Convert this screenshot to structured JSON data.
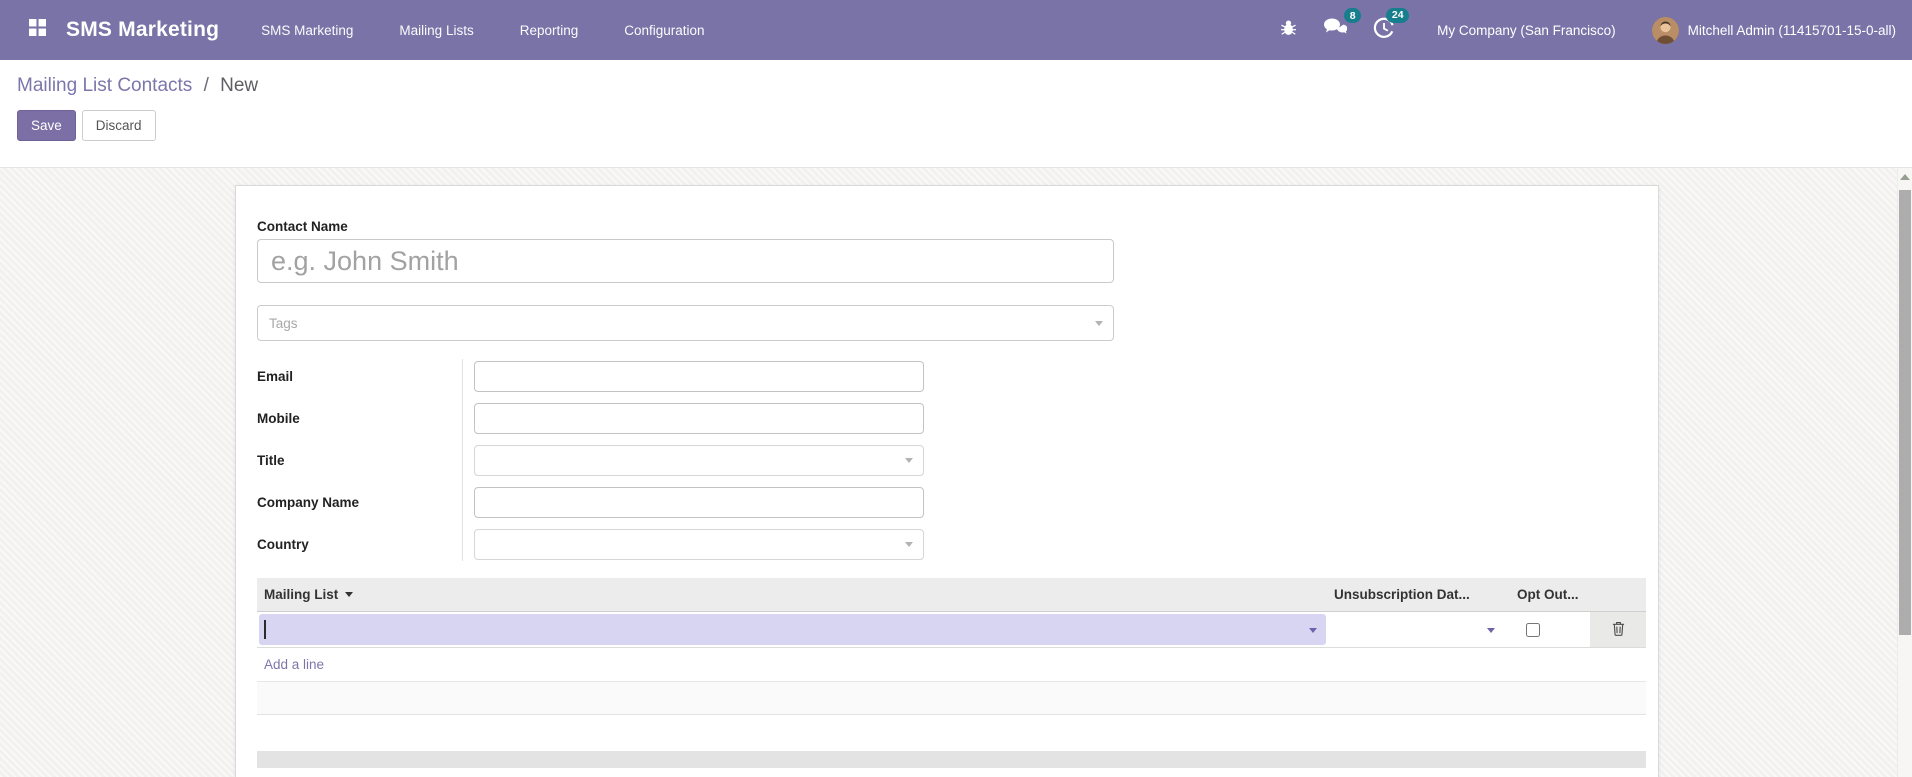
{
  "header": {
    "app_name": "SMS Marketing",
    "menus": [
      {
        "label": "SMS Marketing"
      },
      {
        "label": "Mailing Lists"
      },
      {
        "label": "Reporting"
      },
      {
        "label": "Configuration"
      }
    ],
    "messages_badge": "8",
    "activities_badge": "24",
    "company_name": "My Company (San Francisco)",
    "user_name": "Mitchell Admin (11415701-15-0-all)"
  },
  "breadcrumb": {
    "parent": "Mailing List Contacts",
    "separator": "/",
    "current": "New"
  },
  "actions": {
    "save": "Save",
    "discard": "Discard"
  },
  "form": {
    "contact_name_label": "Contact Name",
    "contact_name_placeholder": "e.g. John Smith",
    "contact_name_value": "",
    "tags_placeholder": "Tags",
    "fields": [
      {
        "label": "Email",
        "value": ""
      },
      {
        "label": "Mobile",
        "value": ""
      },
      {
        "label": "Title",
        "value": ""
      },
      {
        "label": "Company Name",
        "value": ""
      },
      {
        "label": "Country",
        "value": ""
      }
    ],
    "table": {
      "col_mailing_list": "Mailing List",
      "col_unsubscription": "Unsubscription Dat...",
      "col_opt_out": "Opt Out...",
      "opt_out_checked": false,
      "add_line": "Add a line"
    }
  },
  "icons": {
    "apps": "grid-icon",
    "debug": "bug-icon",
    "messages": "chat-icon",
    "activities": "clock-icon",
    "dropdown": "caret-down-icon",
    "sort": "caret-down-icon",
    "delete": "trash-icon",
    "scroll_up": "arrow-up-icon"
  },
  "colors": {
    "header_bg": "#7973a7",
    "accent": "#7c76ab",
    "primary_button": "#7c6fa6",
    "badge": "#177e8e",
    "row_highlight": "#d8d5f2",
    "table_header_bg": "#ececec"
  }
}
